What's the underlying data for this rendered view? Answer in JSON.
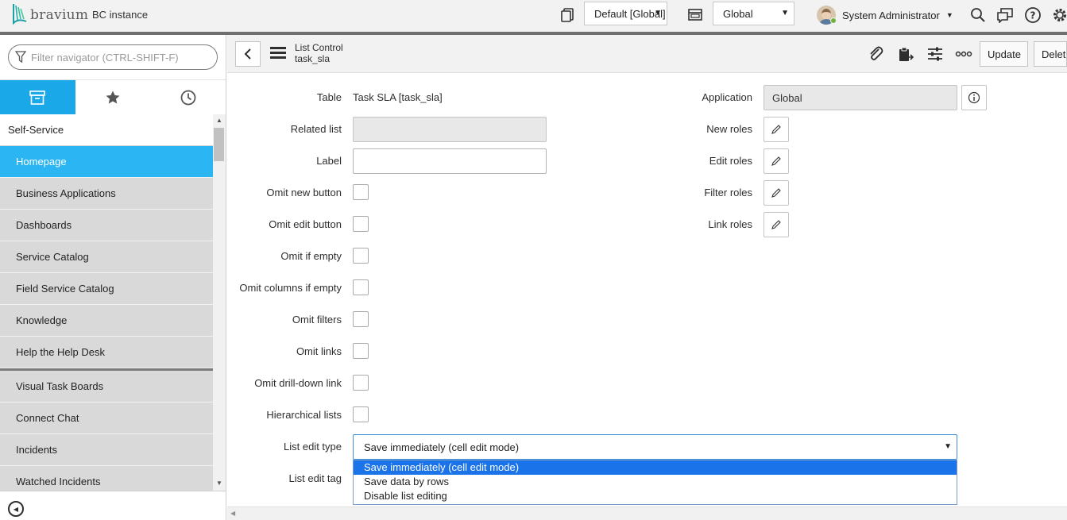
{
  "banner": {
    "logo_text": "bravium",
    "instance": "BC instance",
    "scope_select": "Default [Global]",
    "app_select": "Global",
    "user_name": "System Administrator",
    "colors": {
      "banner_bg": "#f2f2f2",
      "accent": "#29b6f6"
    }
  },
  "navigator": {
    "filter_placeholder": "Filter navigator (CTRL-SHIFT-F)",
    "tabs": [
      {
        "name": "all-apps",
        "icon": "archive-box-icon",
        "active": true
      },
      {
        "name": "favorites",
        "icon": "star-icon",
        "active": false
      },
      {
        "name": "history",
        "icon": "clock-icon",
        "active": false
      }
    ],
    "section": "Self-Service",
    "items": [
      "Homepage",
      "Business Applications",
      "Dashboards",
      "Service Catalog",
      "Field Service Catalog",
      "Knowledge",
      "Help the Help Desk",
      "Visual Task Boards",
      "Connect Chat",
      "Incidents",
      "Watched Incidents"
    ]
  },
  "form_header": {
    "title": "List Control",
    "subtitle": "task_sla",
    "buttons": {
      "update": "Update",
      "delete": "Delete"
    }
  },
  "form": {
    "left_fields": {
      "table": {
        "label": "Table",
        "value": "Task SLA [task_sla]"
      },
      "related_list": {
        "label": "Related list",
        "value": ""
      },
      "label": {
        "label": "Label",
        "value": ""
      },
      "omit_new_button": {
        "label": "Omit new button"
      },
      "omit_edit_button": {
        "label": "Omit edit button"
      },
      "omit_if_empty": {
        "label": "Omit if empty"
      },
      "omit_columns_if_empty": {
        "label": "Omit columns if empty"
      },
      "omit_filters": {
        "label": "Omit filters"
      },
      "omit_links": {
        "label": "Omit links"
      },
      "omit_drill_down_link": {
        "label": "Omit drill-down link"
      },
      "hierarchical_lists": {
        "label": "Hierarchical lists"
      },
      "list_edit_type": {
        "label": "List edit type",
        "value": "Save immediately (cell edit mode)"
      },
      "list_edit_tag": {
        "label": "List edit tag"
      }
    },
    "right_fields": {
      "application": {
        "label": "Application",
        "value": "Global"
      },
      "new_roles": {
        "label": "New roles"
      },
      "edit_roles": {
        "label": "Edit roles"
      },
      "filter_roles": {
        "label": "Filter roles"
      },
      "link_roles": {
        "label": "Link roles"
      }
    },
    "dropdown_options": [
      "Save immediately (cell edit mode)",
      "Save data by rows",
      "Disable list editing"
    ]
  }
}
